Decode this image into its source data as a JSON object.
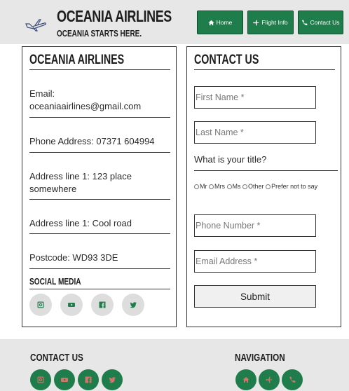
{
  "header": {
    "title": "OCEANIA AIRLINES",
    "tagline": "OCEANIA STARTS HERE.",
    "nav": [
      {
        "label": "Home",
        "icon": "home-icon"
      },
      {
        "label": "Flight Info",
        "icon": "plane-icon"
      },
      {
        "label": "Contact Us",
        "icon": "phone-icon"
      }
    ]
  },
  "info_panel": {
    "heading": "OCEANIA AIRLINES",
    "email_label": "Email:",
    "email": "oceaniaairlines@gmail.com",
    "phone": "Phone Address: 07371 604994",
    "address1": "Address line 1: 123 place somewhere",
    "address2": "Address line 1: Cool road",
    "postcode": "Postcode: WD93 3DE",
    "social_heading": "SOCIAL MEDIA",
    "social_icons": [
      "instagram-icon",
      "youtube-icon",
      "facebook-icon",
      "twitter-icon"
    ]
  },
  "contact_form": {
    "heading": "CONTACT US",
    "first_name_placeholder": "First Name *",
    "last_name_placeholder": "Last Name *",
    "title_question": "What is your title?",
    "title_options": [
      "Mr",
      "Mrs",
      "Ms",
      "Other",
      "Prefer not to say"
    ],
    "phone_placeholder": "Phone Number *",
    "email_placeholder": "Email Address *",
    "submit_label": "Submit"
  },
  "footer": {
    "contact_heading": "CONTACT US",
    "nav_heading": "NAVIGATION",
    "contact_icons": [
      "instagram-icon",
      "youtube-icon",
      "facebook-icon",
      "twitter-icon"
    ],
    "nav_icons": [
      "home-icon",
      "plane-icon",
      "phone-icon"
    ]
  },
  "colors": {
    "accent": "#1f7d4c",
    "header_bg": "#e7e7e7"
  }
}
